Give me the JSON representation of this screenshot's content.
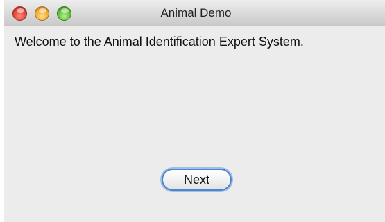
{
  "window": {
    "title": "Animal Demo"
  },
  "content": {
    "welcome_text": "Welcome to the Animal Identification Expert System.",
    "next_button_label": "Next"
  },
  "colors": {
    "close": "#e0443a",
    "minimize": "#f2a935",
    "zoom": "#5fbd3d",
    "focus_ring": "#4d86c8",
    "window_bg": "#ececec"
  }
}
